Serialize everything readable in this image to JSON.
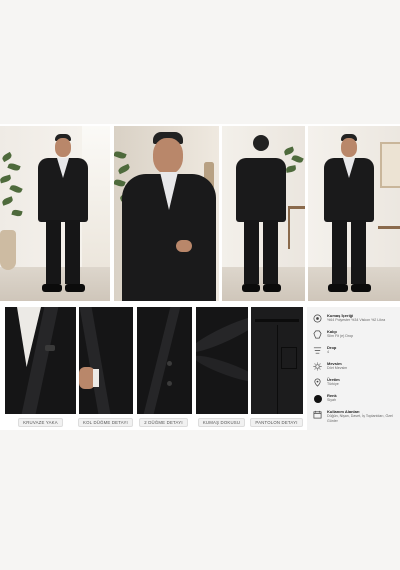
{
  "colors": {
    "suit": "#1a1a1b",
    "page_background": "#f6f5f3",
    "panel": "#f3f3f3",
    "swatch_black": "#111111"
  },
  "photos": [
    {
      "name": "front-pose-hands-in-pockets"
    },
    {
      "name": "closeup-smiling"
    },
    {
      "name": "back-view"
    },
    {
      "name": "front-full"
    }
  ],
  "details": [
    {
      "caption": "KRUVAZE YAKA"
    },
    {
      "caption": "KOL DÜĞME DETAYI"
    },
    {
      "caption": "2 DÜĞME DETAYI"
    },
    {
      "caption": "KUMAŞ DOKUSU"
    },
    {
      "caption": "PANTOLON DETAYI"
    }
  ],
  "specs": [
    {
      "icon": "fabric-icon",
      "title": "Kumaş İçeriği",
      "value": "%64 Polyester %34 Viskon %2 Likra"
    },
    {
      "icon": "cut-icon",
      "title": "Kalıp",
      "value": "Slim Fit (e) Drop"
    },
    {
      "icon": "drop-icon",
      "title": "Drop",
      "value": "4"
    },
    {
      "icon": "season-icon",
      "title": "Mevsim",
      "value": "Dört Mevsim"
    },
    {
      "icon": "origin-icon",
      "title": "Üretim",
      "value": "Türkiye"
    },
    {
      "icon": "color-swatch",
      "title": "Renk",
      "value": "Siyah"
    },
    {
      "icon": "calendar-icon",
      "title": "Kullanım Alanları",
      "value": "Düğün, Nişan, Davet, İş Toplantıları, Özel Günler"
    }
  ]
}
